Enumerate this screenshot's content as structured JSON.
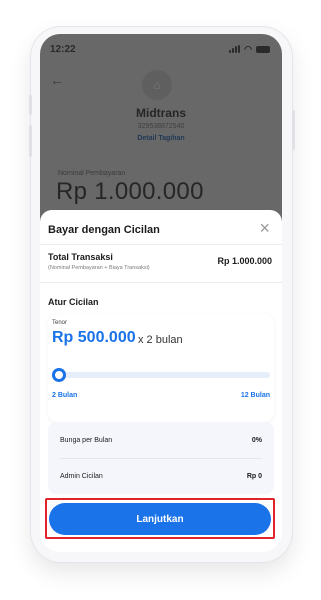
{
  "status_bar": {
    "time": "12:22"
  },
  "merchant": {
    "name": "Midtrans",
    "id": "329538872540",
    "detail_link": "Detail Tagihan",
    "nominal_label": "Nominal Pembayaran",
    "nominal_amount": "Rp 1.000.000"
  },
  "sheet": {
    "title": "Bayar dengan Cicilan",
    "close_icon": "close-icon",
    "total": {
      "label": "Total Transaksi",
      "sub": "(Nominal Pembayaran + Biaya Transaksi)",
      "value": "Rp 1.000.000"
    },
    "atur_label": "Atur Cicilan",
    "tenor": {
      "label": "Tenor",
      "amount": "Rp 500.000",
      "suffix": "x 2 bulan",
      "min_label": "2 Bulan",
      "max_label": "12 Bulan",
      "slider_fraction": 0
    },
    "info": [
      {
        "label": "Bunga per Bulan",
        "value": "0%"
      },
      {
        "label": "Admin Cicilan",
        "value": "Rp 0"
      }
    ],
    "cta_label": "Lanjutkan"
  },
  "colors": {
    "accent": "#1a73e8",
    "highlight": "#e0242a",
    "overlay": "#686868"
  }
}
